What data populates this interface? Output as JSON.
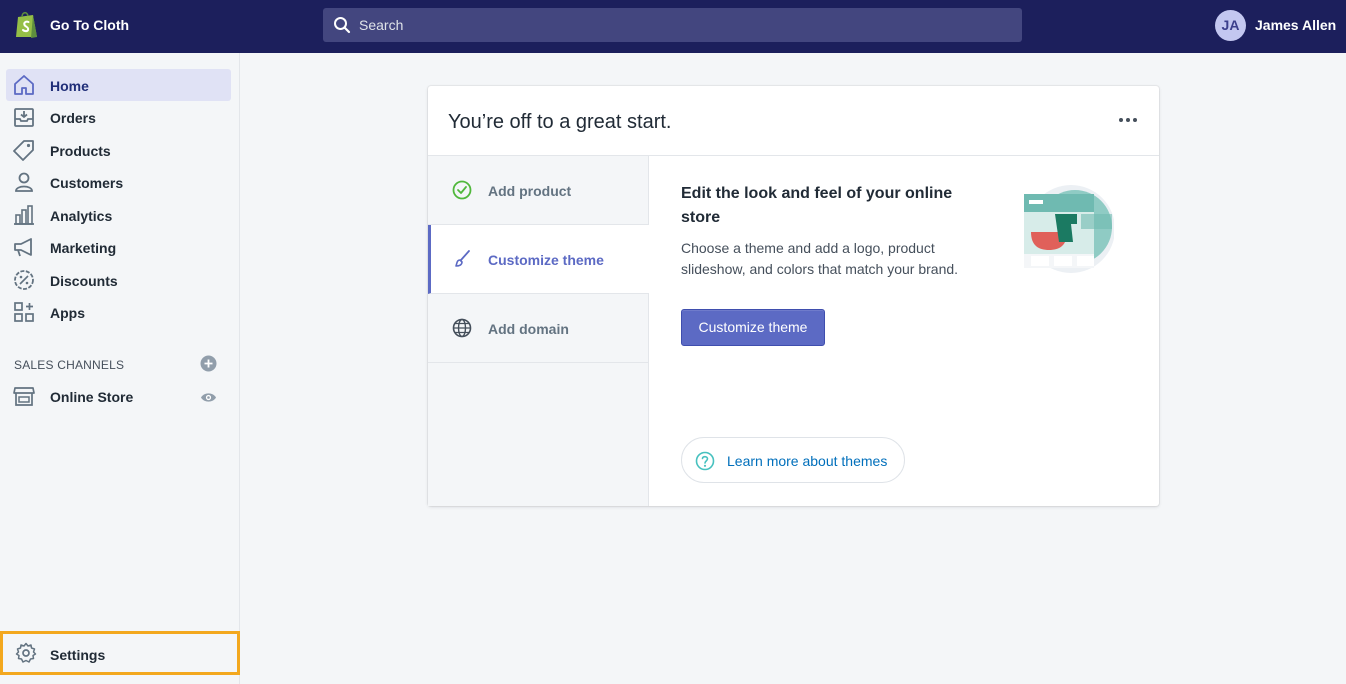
{
  "colors": {
    "topbar": "#1c1f5c",
    "accent": "#5c6ac4",
    "highlight": "#f3a81f",
    "link": "#006fbb"
  },
  "topbar": {
    "store_name": "Go To Cloth",
    "logo_icon": "shopify-bag-icon",
    "search_placeholder": "Search",
    "avatar_initials": "JA",
    "user_name": "James Allen"
  },
  "sidebar": {
    "items": [
      {
        "label": "Home",
        "icon": "home-icon",
        "active": true
      },
      {
        "label": "Orders",
        "icon": "orders-icon"
      },
      {
        "label": "Products",
        "icon": "tag-icon"
      },
      {
        "label": "Customers",
        "icon": "person-icon"
      },
      {
        "label": "Analytics",
        "icon": "bar-chart-icon"
      },
      {
        "label": "Marketing",
        "icon": "megaphone-icon"
      },
      {
        "label": "Discounts",
        "icon": "discount-icon"
      },
      {
        "label": "Apps",
        "icon": "apps-grid-icon"
      }
    ],
    "sales_channels_title": "SALES CHANNELS",
    "channels": [
      {
        "label": "Online Store",
        "icon": "storefront-icon"
      }
    ],
    "settings_label": "Settings"
  },
  "card": {
    "title": "You’re off to a great start.",
    "tabs": [
      {
        "label": "Add product",
        "icon": "check-circle-icon",
        "completed": true
      },
      {
        "label": "Customize theme",
        "icon": "paintbrush-icon",
        "active": true
      },
      {
        "label": "Add domain",
        "icon": "globe-icon"
      }
    ],
    "content": {
      "heading": "Edit the look and feel of your online store",
      "description": "Choose a theme and add a logo, product slideshow, and colors that match your brand.",
      "button_label": "Customize theme",
      "learn_more_label": "Learn more about themes"
    }
  }
}
